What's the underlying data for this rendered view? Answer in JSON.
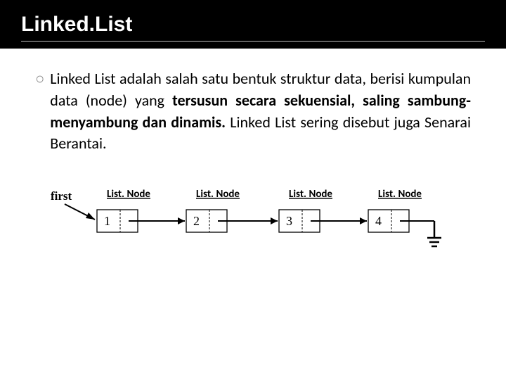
{
  "title": "Linked.List",
  "body": {
    "lead": "Linked List adalah salah satu bentuk struktur data, berisi kumpulan data (node) yang ",
    "bold1": "tersusun secara sekuensial, saling sambung-menyambung dan dinamis.",
    "rest": " Linked List sering disebut juga Senarai Berantai."
  },
  "diagram": {
    "first_label": "first",
    "node_label": "List. Node",
    "nodes": [
      {
        "value": "1"
      },
      {
        "value": "2"
      },
      {
        "value": "3"
      },
      {
        "value": "4"
      }
    ]
  }
}
